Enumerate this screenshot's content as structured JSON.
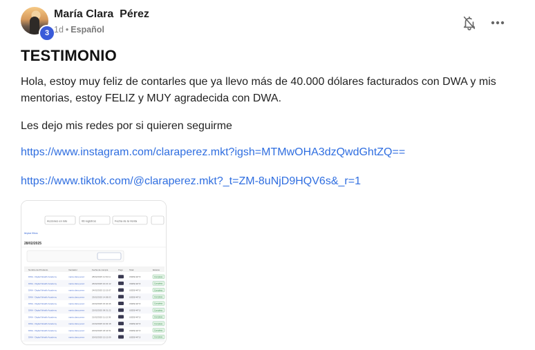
{
  "author": {
    "name": "María Clara  Pérez",
    "level": "3",
    "time": "1d",
    "separator": "•",
    "language": "Español"
  },
  "post": {
    "title": "TESTIMONIO",
    "paragraph1": "Hola, estoy muy feliz de contarles que ya llevo más de 40.000 dólares facturados con DWA y mis mentorias, estoy FELIZ y MUY agradecida con DWA.",
    "paragraph2": "Les dejo mis redes por si quieren seguirme",
    "link1": "https://www.instagram.com/claraperez.mkt?igsh=MTMwOHA3dzQwdGhtZQ==",
    "link2": "https://www.tiktok.com/@claraperez.mkt?_t=ZM-8uNjD9HQV6s&_r=1"
  },
  "icons": {
    "bell": "bell-off-icon",
    "more": "more-horizontal-icon"
  },
  "attachment": {
    "toolbar": [
      "Acciones en lote",
      "06 registros",
      "Fecha de la Venta"
    ],
    "date": "28/02/2025",
    "columns": [
      "Nombre del Producto",
      "Vendedor",
      "Fecha de compra",
      "Pago",
      "Total",
      "Estatus"
    ],
    "rows": [
      {
        "product": "DWA - Digital Wealth Academy",
        "seller": "maria clara perez",
        "date": "28/02/2025 11:54:11",
        "total": "USD$ 447,5",
        "status": "Completa"
      },
      {
        "product": "DWA - Digital Wealth Academy",
        "seller": "maria clara perez",
        "date": "26/02/2025 10:21:12",
        "total": "USD$ 447,5",
        "status": "Completa"
      },
      {
        "product": "DWA - Digital Wealth Academy",
        "seller": "maria clara perez",
        "date": "24/02/2025 12:15:07",
        "total": "USD$ 447,5",
        "status": "Completa"
      },
      {
        "product": "DWA - Digital Wealth Academy",
        "seller": "maria clara perez",
        "date": "23/02/2025 14:08:03",
        "total": "USD$ 447,5",
        "status": "Completa"
      },
      {
        "product": "DWA - Digital Wealth Academy",
        "seller": "maria clara perez",
        "date": "22/02/2025 15:40:46",
        "total": "USD$ 447,5",
        "status": "Completa"
      },
      {
        "product": "DWA - Digital Wealth Academy",
        "seller": "maria clara perez",
        "date": "22/02/2025 09:31:22",
        "total": "USD$ 447,5",
        "status": "Completa"
      },
      {
        "product": "DWA - Digital Wealth Academy",
        "seller": "maria clara perez",
        "date": "21/02/2025 11:12:36",
        "total": "USD$ 447,5",
        "status": "Completa"
      },
      {
        "product": "DWA - Digital Wealth Academy",
        "seller": "maria clara perez",
        "date": "21/02/2025 10:02:18",
        "total": "USD$ 447,5",
        "status": "Completa"
      },
      {
        "product": "DWA - Digital Wealth Academy",
        "seller": "maria clara perez",
        "date": "20/02/2025 18:44:51",
        "total": "USD$ 447,5",
        "status": "Completa"
      },
      {
        "product": "DWA - Digital Wealth Academy",
        "seller": "maria clara perez",
        "date": "20/02/2025 12:12:09",
        "total": "USD$ 447,5",
        "status": "Completa"
      }
    ]
  }
}
